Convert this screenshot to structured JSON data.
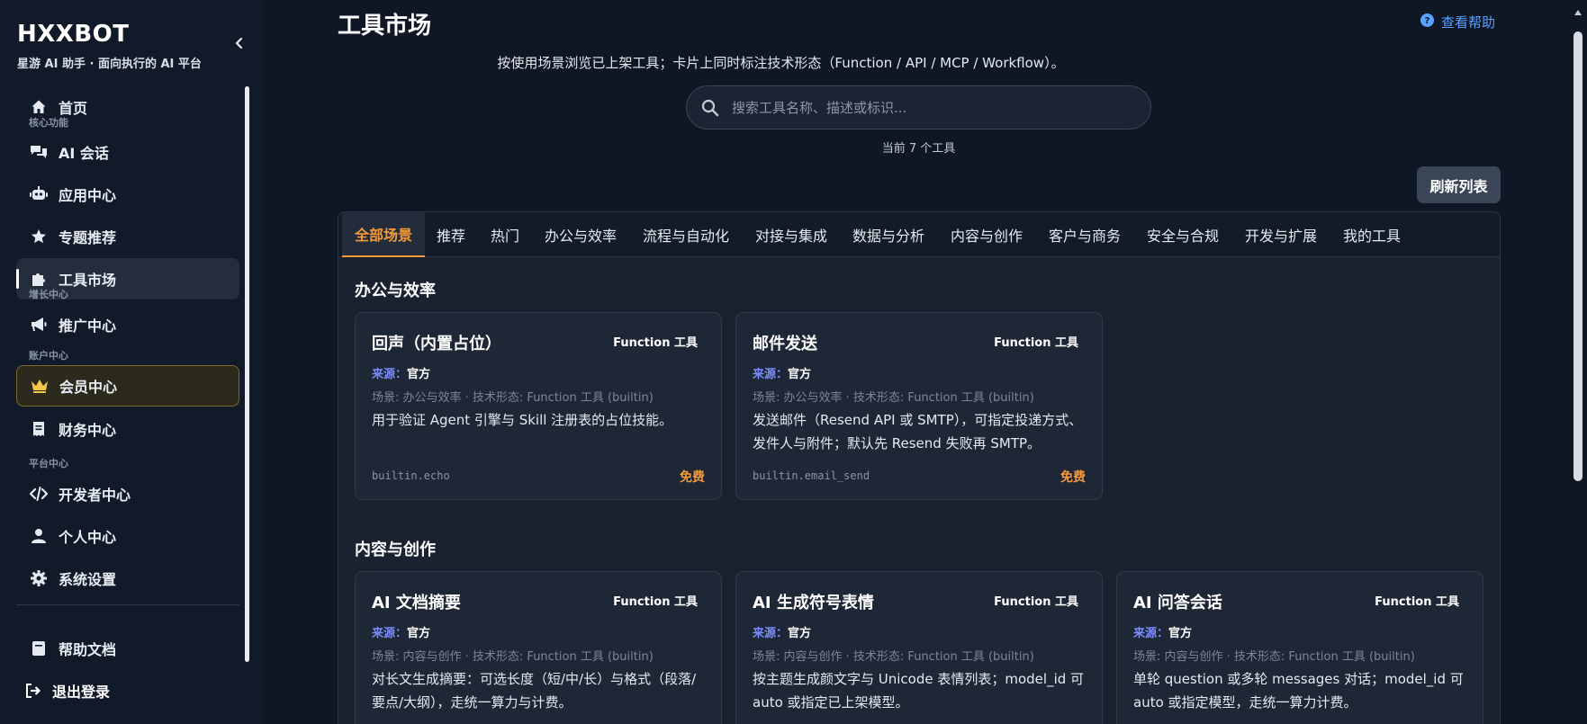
{
  "brand": {
    "title": "HXXBOT",
    "subtitle": "星游 AI 助手 · 面向执行的 AI 平台"
  },
  "sidebar": {
    "home": "首页",
    "section_core": "核心功能",
    "chat": "AI 会话",
    "apps": "应用中心",
    "topics": "专题推荐",
    "tools": "工具市场",
    "section_growth": "增长中心",
    "promo": "推广中心",
    "section_account": "账户中心",
    "vip": "会员中心",
    "finance": "财务中心",
    "section_platform": "平台中心",
    "developer": "开发者中心",
    "profile": "个人中心",
    "settings": "系统设置",
    "help_docs": "帮助文档",
    "logout": "退出登录"
  },
  "page": {
    "title": "工具市场",
    "help": "查看帮助",
    "subtitle": "按使用场景浏览已上架工具；卡片上同时标注技术形态（Function / API / MCP / Workflow）。",
    "search_placeholder": "搜索工具名称、描述或标识...",
    "count": "当前 7 个工具",
    "refresh": "刷新列表"
  },
  "tabs": [
    "全部场景",
    "推荐",
    "热门",
    "办公与效率",
    "流程与自动化",
    "对接与集成",
    "数据与分析",
    "内容与创作",
    "客户与商务",
    "安全与合规",
    "开发与扩展",
    "我的工具"
  ],
  "sections": [
    {
      "title": "办公与效率",
      "cards": [
        {
          "title": "回声（内置占位）",
          "type": "Function 工具",
          "source_label": "来源：",
          "source": "官方",
          "meta": "场景: 办公与效率 · 技术形态: Function 工具 (builtin)",
          "desc": "用于验证 Agent 引擎与 Skill 注册表的占位技能。",
          "id": "builtin.echo",
          "price": "免费"
        },
        {
          "title": "邮件发送",
          "type": "Function 工具",
          "source_label": "来源：",
          "source": "官方",
          "meta": "场景: 办公与效率 · 技术形态: Function 工具 (builtin)",
          "desc": "发送邮件（Resend API 或 SMTP），可指定投递方式、发件人与附件；默认先 Resend 失败再 SMTP。",
          "id": "builtin.email_send",
          "price": "免费"
        }
      ]
    },
    {
      "title": "内容与创作",
      "cards": [
        {
          "title": "AI 文档摘要",
          "type": "Function 工具",
          "source_label": "来源：",
          "source": "官方",
          "meta": "场景: 内容与创作 · 技术形态: Function 工具 (builtin)",
          "desc": "对长文生成摘要：可选长度（短/中/长）与格式（段落/要点/大纲），走统一算力与计费。"
        },
        {
          "title": "AI 生成符号表情",
          "type": "Function 工具",
          "source_label": "来源：",
          "source": "官方",
          "meta": "场景: 内容与创作 · 技术形态: Function 工具 (builtin)",
          "desc": "按主题生成颜文字与 Unicode 表情列表；model_id 可 auto 或指定已上架模型。"
        },
        {
          "title": "AI 问答会话",
          "type": "Function 工具",
          "source_label": "来源：",
          "source": "官方",
          "meta": "场景: 内容与创作 · 技术形态: Function 工具 (builtin)",
          "desc": "单轮 question 或多轮 messages 对话；model_id 可 auto 或指定模型，走统一算力计费。"
        }
      ]
    }
  ],
  "colors": {
    "accent": "#f59a3a",
    "link": "#5aa2ff",
    "source_label": "#7b8cff",
    "vip_border": "#7a6a2a"
  }
}
